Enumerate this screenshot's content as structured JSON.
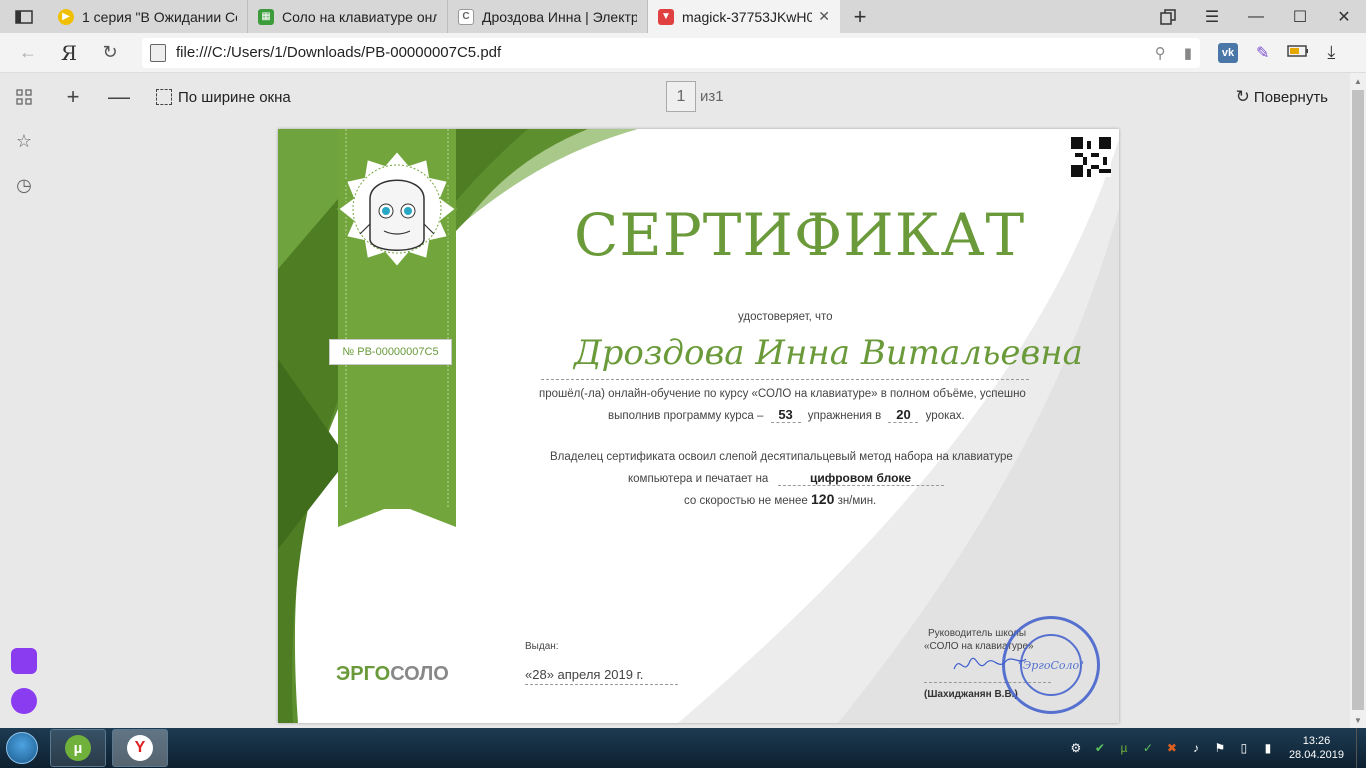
{
  "tabs": [
    {
      "title": "1 серия \"В Ожидании Соло\"",
      "favicon": "youtube-icon",
      "color": "#f0c000"
    },
    {
      "title": "Соло на клавиатуре онлайн",
      "favicon": "solo-icon",
      "color": "#3c9c3c"
    },
    {
      "title": "Дроздова Инна | Электронный",
      "favicon": "c-icon",
      "color": "#999999"
    },
    {
      "title": "magick-37753JKwH07jN",
      "favicon": "pdf-icon",
      "color": "#e04040",
      "active": true
    }
  ],
  "address": {
    "brand": "Я",
    "url": "file:///C:/Users/1/Downloads/PB-00000007C5.pdf"
  },
  "pdf_toolbar": {
    "fit_label": "По ширине окна",
    "page_current": "1",
    "page_of": "из1",
    "rotate_label": "Повернуть"
  },
  "certificate": {
    "title": "СЕРТИФИКАТ",
    "certifies": "удостоверяет, что",
    "name": "Дроздова Инна Витальевна",
    "line1": "прошёл(-ла) онлайн-обучение по курсу «СОЛО на клавиатуре» в полном объёме, успешно",
    "line2_pre": "выполнив программу курса –",
    "exercises": "53",
    "line2_mid": "упражнения в",
    "lessons": "20",
    "line2_post": "уроках.",
    "line3": "Владелец сертификата освоил слепой десятипальцевый метод набора на клавиатуре",
    "line4_pre": "компьютера и печатает на",
    "block": "цифровом блоке",
    "line5_pre": "со скоростью не менее",
    "speed": "120",
    "line5_post": "зн/мин.",
    "number": "№ PB-00000007C5",
    "issued_label": "Выдан:",
    "issued_date": "«28»  апреля  2019 г.",
    "head_line1": "Руководитель школы",
    "head_line2": "«СОЛО на клавиатуре»",
    "signer": "(Шахиджанян В.В.)",
    "stamp_text": "\"ЭргоСоло\"",
    "logo_ergo": "ЭРГО",
    "logo_solo": "СОЛО"
  },
  "taskbar": {
    "time": "13:26",
    "date": "28.04.2019"
  }
}
